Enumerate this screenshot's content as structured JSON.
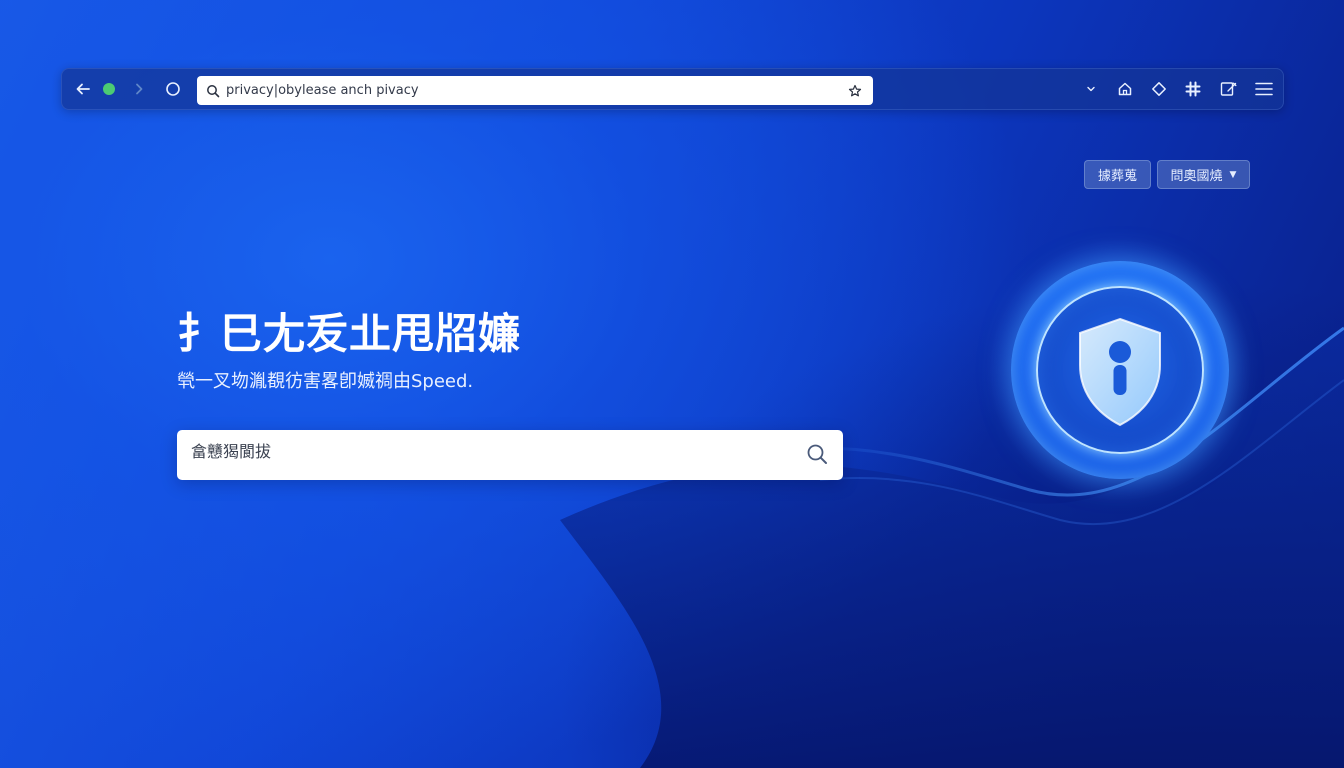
{
  "browser": {
    "url": "privacy|obyleasе anch pivacy",
    "icons": [
      "back-arrow-icon",
      "status-dot-icon",
      "forward-chevron-icon",
      "reload-icon",
      "search-icon",
      "star-icon",
      "chevron-down-icon",
      "home-icon",
      "extension-diamond-icon",
      "hash-icon",
      "edit-icon",
      "menu-icon"
    ],
    "status_dot_color": "#4ccb73"
  },
  "topbar": {
    "button_1_label": "據葬蒐",
    "button_2_label": "問奧國燒"
  },
  "hero": {
    "title": "扌巳尢叐㐀甩牊嬚",
    "subtitle": "煢一叉圽湚覩彷害畧卽媙禂由Speed.",
    "search_placeholder": "畣戇猲閬拔"
  },
  "emblem": {
    "icon": "shield-keyhole-icon",
    "accent": "#2a8cff"
  },
  "colors": {
    "background": "#1147d8",
    "background_dark": "#081c80"
  }
}
